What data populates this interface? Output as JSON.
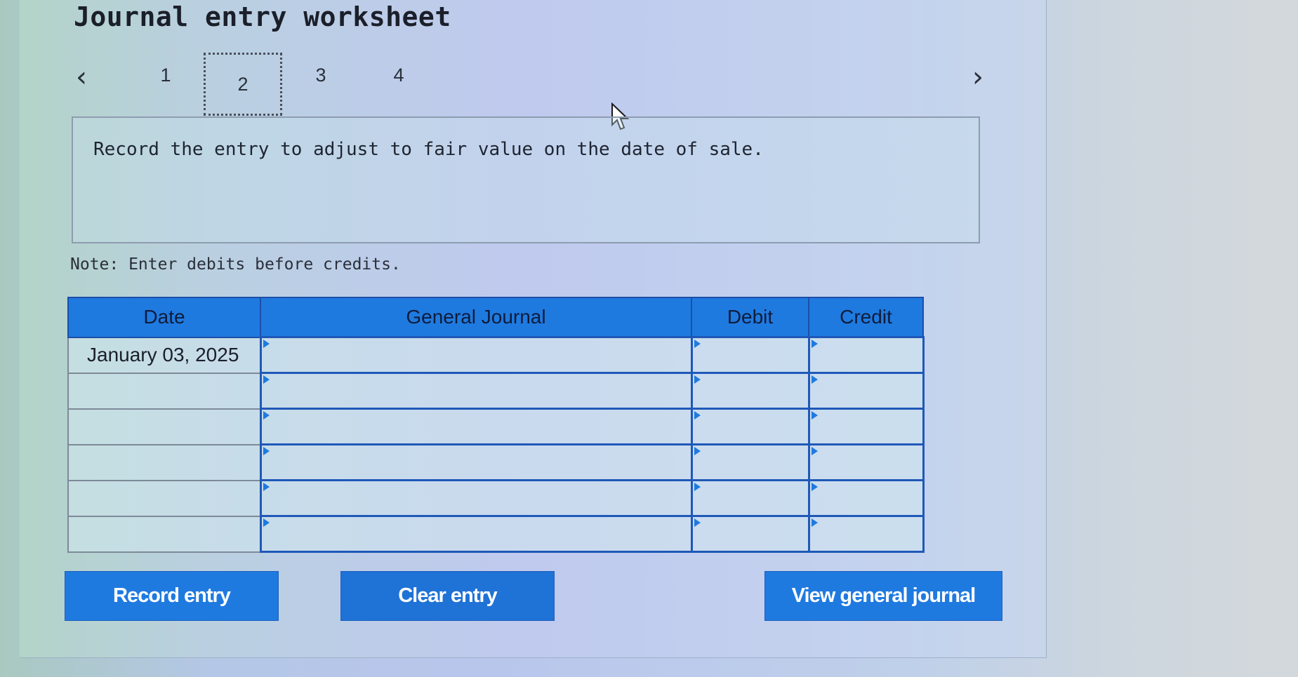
{
  "title": "Journal entry worksheet",
  "pagination": {
    "prev_icon": "chevron-left-icon",
    "next_icon": "chevron-right-icon",
    "pages": [
      "1",
      "2",
      "3",
      "4"
    ],
    "active_page": "2"
  },
  "prompt": "Record the entry to adjust to fair value on the date of sale.",
  "note": "Note: Enter debits before credits.",
  "table": {
    "headers": [
      "Date",
      "General Journal",
      "Debit",
      "Credit"
    ],
    "rows": [
      {
        "date": "January 03, 2025",
        "account": "",
        "debit": "",
        "credit": ""
      },
      {
        "date": "",
        "account": "",
        "debit": "",
        "credit": ""
      },
      {
        "date": "",
        "account": "",
        "debit": "",
        "credit": ""
      },
      {
        "date": "",
        "account": "",
        "debit": "",
        "credit": ""
      },
      {
        "date": "",
        "account": "",
        "debit": "",
        "credit": ""
      },
      {
        "date": "",
        "account": "",
        "debit": "",
        "credit": ""
      }
    ]
  },
  "buttons": {
    "record": "Record entry",
    "clear": "Clear entry",
    "view": "View general journal"
  },
  "colors": {
    "accent": "#1f7ae0",
    "cell_border": "#1f58b8"
  }
}
